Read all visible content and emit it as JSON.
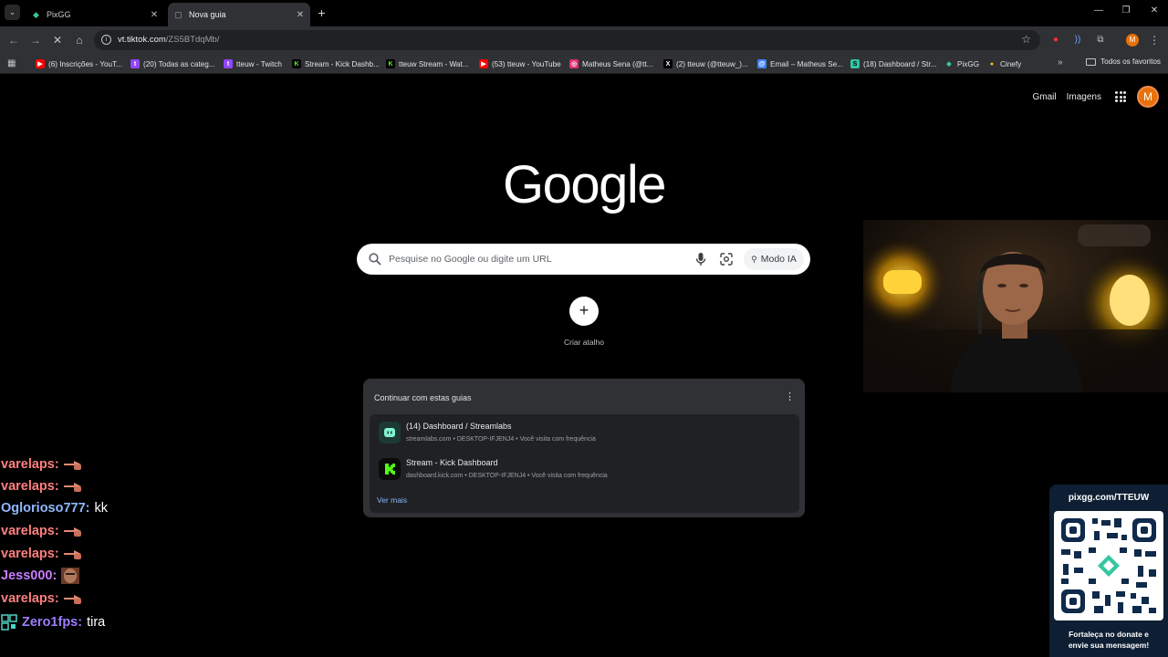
{
  "browser": {
    "tabs": [
      {
        "label": "PixGG",
        "active": false
      },
      {
        "label": "Nova guia",
        "active": true
      }
    ],
    "address": {
      "host": "vt.tiktok.com",
      "path": "/ZS5BTdqMb/"
    },
    "profile_initial": "M"
  },
  "bookmarks": {
    "items": [
      {
        "label": "(6) Inscrições - YouT...",
        "color": "#ff0000"
      },
      {
        "label": "(20) Todas as categ...",
        "color": "#9146ff"
      },
      {
        "label": "tteuw - Twitch",
        "color": "#9146ff"
      },
      {
        "label": "Stream - Kick Dashb...",
        "color": "#53fc18"
      },
      {
        "label": "tteuw Stream - Wat...",
        "color": "#53fc18"
      },
      {
        "label": "(53) tteuw - YouTube",
        "color": "#ff0000"
      },
      {
        "label": "Matheus Sena (@tt...",
        "color": "#e1306c"
      },
      {
        "label": "(2) tteuw (@tteuw_)...",
        "color": "#ffffff"
      },
      {
        "label": "Email – Matheus Se...",
        "color": "#4285f4"
      },
      {
        "label": "(18) Dashboard / Str...",
        "color": "#31c3a2"
      },
      {
        "label": "PixGG",
        "color": "#36c6a0"
      },
      {
        "label": "Cinefy",
        "color": "#f5c518"
      }
    ],
    "all_label": "Todos os favoritos"
  },
  "google": {
    "gmail": "Gmail",
    "images": "Imagens",
    "avatar_initial": "M",
    "logo_text": "Google",
    "search_placeholder": "Pesquise no Google ou digite um URL",
    "ai_mode": "Modo IA",
    "shortcut_label": "Criar atalho"
  },
  "continue_card": {
    "title": "Continuar com estas guias",
    "items": [
      {
        "title": "(14) Dashboard / Streamlabs",
        "subtitle": "streamlabs.com • DESKTOP-IFJENJ4 • Você visita com frequência",
        "icon_color": "#80f5d2"
      },
      {
        "title": "Stream - Kick Dashboard",
        "subtitle": "dashboard.kick.com • DESKTOP-IFJENJ4 • Você visita com frequência",
        "icon_color": "#53fc18"
      }
    ],
    "more": "Ver mais"
  },
  "chat": [
    {
      "user": "varelaps:",
      "msg": "",
      "color": "#ff7f7f",
      "emote": "hand"
    },
    {
      "user": "varelaps:",
      "msg": "",
      "color": "#ff7f7f",
      "emote": "hand"
    },
    {
      "user": "Oglorioso777:",
      "msg": "kk",
      "color": "#8fb8ff",
      "emote": ""
    },
    {
      "user": "varelaps:",
      "msg": "",
      "color": "#ff7f7f",
      "emote": "hand"
    },
    {
      "user": "varelaps:",
      "msg": "",
      "color": "#ff7f7f",
      "emote": "hand"
    },
    {
      "user": "Jess000:",
      "msg": "",
      "color": "#c77dff",
      "emote": "face"
    },
    {
      "user": "varelaps:",
      "msg": "",
      "color": "#ff7f7f",
      "emote": "hand"
    },
    {
      "user": "Zero1fps:",
      "msg": "tira",
      "color": "#9d7dff",
      "emote": ""
    }
  ],
  "pix": {
    "url": "pixgg.com/TTEUW",
    "line1": "Fortaleça no donate e",
    "line2": "envie sua mensagem!"
  }
}
